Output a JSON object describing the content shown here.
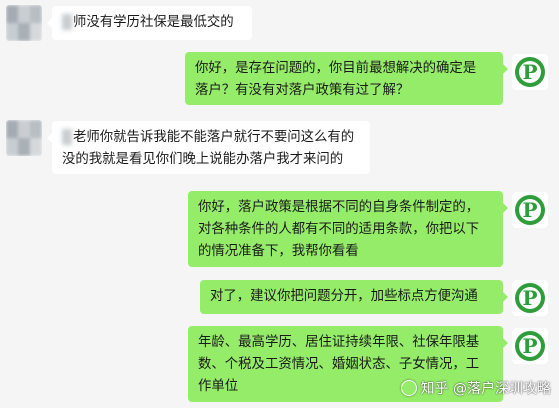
{
  "colors": {
    "background": "#f5f5f5",
    "incoming_bubble": "#ffffff",
    "outgoing_bubble": "#95ec69",
    "logo_green": "#2f9d3a"
  },
  "messages": [
    {
      "side": "left",
      "lines": [
        "师没有学历社保是最低交的"
      ]
    },
    {
      "side": "right",
      "lines": [
        "你好，是存在问题的，你目前最想解决的确定是",
        "落户？有没有对落户政策有过了解？"
      ]
    },
    {
      "side": "left",
      "lines": [
        "老师你就告诉我能不能落户就行不要问这么有的",
        "没的我就是看见你们晚上说能办落户我才来问的"
      ]
    },
    {
      "side": "right",
      "lines": [
        "你好，落户政策是根据不同的自身条件制定的，",
        "对各种条件的人都有不同的适用条款，你把以下",
        "的情况准备下，我帮你看看"
      ]
    },
    {
      "side": "right",
      "lines": [
        "对了，建议你把问题分开，加些标点方便沟通"
      ]
    },
    {
      "side": "right",
      "lines": [
        "年龄、最高学历、居住证持续年限、社保年限基",
        "数、个税及工资情况、婚姻状态、子女情况，工",
        "作单位"
      ]
    }
  ],
  "logo_letter": "P",
  "watermark": {
    "text": "知乎 @落户深圳攻略",
    "icon": "wechat-circle-icon"
  }
}
